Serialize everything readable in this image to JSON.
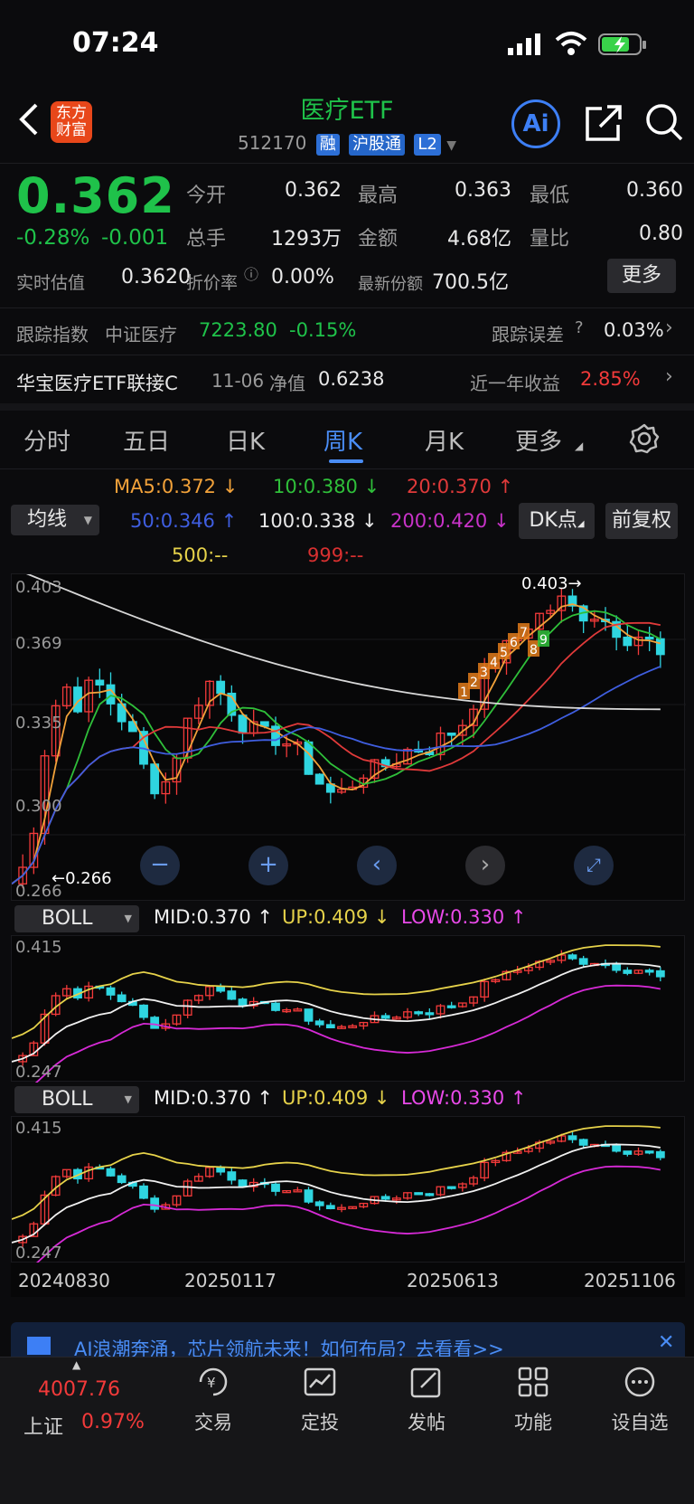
{
  "status_bar": {
    "time": "07:24"
  },
  "header": {
    "title": "医疗ETF",
    "code": "512170",
    "tags": [
      "融",
      "沪股通",
      "L2"
    ],
    "ai_label": "Ai"
  },
  "quote": {
    "price": "0.362",
    "change_pct": "-0.28%",
    "change_abs": "-0.001",
    "fields": [
      {
        "label": "今开",
        "value": "0.362",
        "color": "green"
      },
      {
        "label": "最高",
        "value": "0.363",
        "color": "white"
      },
      {
        "label": "最低",
        "value": "0.360",
        "color": "green"
      },
      {
        "label": "总手",
        "value": "1293万",
        "color": "white"
      },
      {
        "label": "金额",
        "value": "4.68亿",
        "color": "white"
      },
      {
        "label": "量比",
        "value": "0.80",
        "color": "white"
      }
    ],
    "est_label": "实时估值",
    "est_value": "0.3620",
    "premium_label": "折价率",
    "premium_value": "0.00%",
    "shares_label": "最新份额",
    "shares_value": "700.5亿",
    "more_label": "更多"
  },
  "tracking": {
    "index_label": "跟踪指数",
    "index_name": "中证医疗",
    "index_value": "7223.80",
    "index_change": "-0.15%",
    "error_label": "跟踪误差",
    "error_value": "0.03%"
  },
  "linked_fund": {
    "name": "华宝医疗ETF联接C",
    "date": "11-06",
    "nav_label": "净值",
    "nav": "0.6238",
    "return_label": "近一年收益",
    "return_value": "2.85%"
  },
  "tabs": [
    "分时",
    "五日",
    "日K",
    "周K",
    "月K",
    "更多"
  ],
  "ma_legend": {
    "selector": "均线",
    "ma5": "MA5:0.372 ↓",
    "ma10": "10:0.380 ↓",
    "ma20": "20:0.370 ↑",
    "ma50": "50:0.346 ↑",
    "ma100": "100:0.338 ↓",
    "ma200": "200:0.420 ↓",
    "ma500": "500:--",
    "ma999": "999:--",
    "dk_label": "DK点",
    "fq_label": "前复权"
  },
  "colors": {
    "ma5": "#f2a23a",
    "ma10": "#2fbf3a",
    "ma20": "#e03a3a",
    "ma50": "#3f5ee0",
    "ma100": "#d8d8d8",
    "ma200": "#c833c8",
    "ma500": "#e6d24a",
    "ma999": "#d83030",
    "up": "#f23a3a",
    "down": "#2fd5e0",
    "boll_up": "#e6d24a",
    "boll_low": "#d62ad6",
    "boll_mid": "#f0f0f0"
  },
  "main_chart": {
    "y_labels": [
      "0.403",
      "0.369",
      "0.335",
      "0.300",
      "0.266"
    ],
    "high_mark": "0.403",
    "low_mark": "0.266",
    "dk_numbers": [
      "1",
      "2",
      "3",
      "4",
      "5",
      "6",
      "7",
      "8",
      "9"
    ]
  },
  "boll_panels": [
    {
      "selector": "BOLL",
      "mid": "MID:0.370 ↑",
      "up": "UP:0.409 ↓",
      "low": "LOW:0.330 ↑",
      "y_top": "0.415",
      "y_bottom": "0.247"
    },
    {
      "selector": "BOLL",
      "mid": "MID:0.370 ↑",
      "up": "UP:0.409 ↓",
      "low": "LOW:0.330 ↑",
      "y_top": "0.415",
      "y_bottom": "0.247"
    }
  ],
  "x_dates": [
    "20240830",
    "20250117",
    "20250613",
    "20251106"
  ],
  "banner": {
    "text": "AI浪潮奔涌，芯片领航未来！如何布局？去看看>>"
  },
  "bottom_nav": {
    "index_value": "4007.76",
    "index_name": "上证",
    "index_change": "0.97%",
    "items": [
      "交易",
      "定投",
      "发帖",
      "功能",
      "设自选"
    ]
  }
}
